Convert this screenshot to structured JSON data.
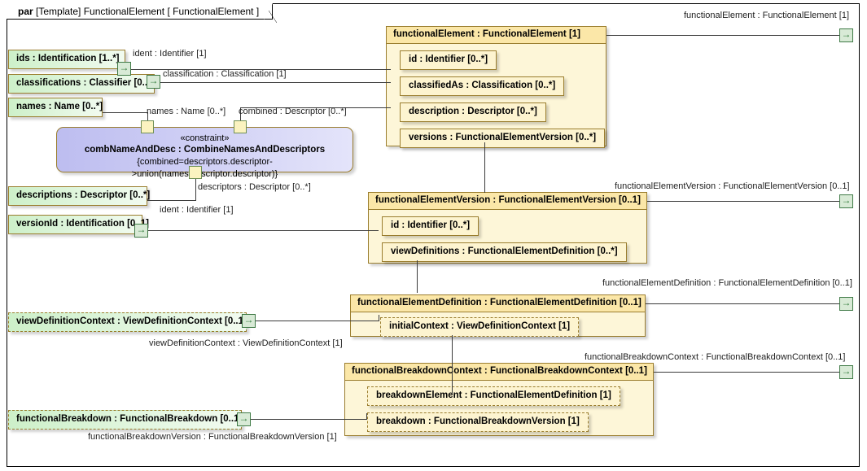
{
  "frame": {
    "keyword": "par",
    "title": "[Template] FunctionalElement [ FunctionalElement ]"
  },
  "blocks": [
    {
      "id": "functionalElement",
      "header": "functionalElement : FunctionalElement [1]",
      "properties": [
        "id : Identifier [0..*]",
        "classifiedAs : Classification [0..*]",
        "description : Descriptor [0..*]",
        "versions : FunctionalElementVersion [0..*]"
      ]
    },
    {
      "id": "functionalElementVersion",
      "header": "functionalElementVersion : FunctionalElementVersion [0..1]",
      "properties": [
        "id : Identifier [0..*]",
        "viewDefinitions : FunctionalElementDefinition [0..*]"
      ]
    },
    {
      "id": "functionalElementDefinition",
      "header": "functionalElementDefinition : FunctionalElementDefinition [0..1]",
      "properties": [
        "initialContext : ViewDefinitionContext [1]"
      ]
    },
    {
      "id": "functionalBreakdownContext",
      "header": "functionalBreakdownContext : FunctionalBreakdownContext [0..1]",
      "properties": [
        "breakdownElement : FunctionalElementDefinition [1]",
        "breakdown : FunctionalBreakdownVersion [1]"
      ]
    }
  ],
  "external_parts": [
    {
      "id": "ids",
      "label": "ids : Identification [1..*]"
    },
    {
      "id": "classifications",
      "label": "classifications : Classifier [0..*]"
    },
    {
      "id": "names",
      "label": "names : Name [0..*]"
    },
    {
      "id": "descriptions",
      "label": "descriptions : Descriptor [0..*]"
    },
    {
      "id": "versionId",
      "label": "versionId : Identification [0..1]"
    },
    {
      "id": "viewDefinitionContext",
      "label": "viewDefinitionContext : ViewDefinitionContext [0..1]"
    },
    {
      "id": "functionalBreakdown",
      "label": "functionalBreakdown : FunctionalBreakdown [0..1]"
    }
  ],
  "constraint": {
    "stereotype": "«constraint»",
    "name": "combNameAndDesc : CombineNamesAndDescriptors",
    "expression": "{combined=descriptors.descriptor->union(names.descriptor.descriptor)}"
  },
  "edge_labels": {
    "ident_1": "ident : Identifier [1]",
    "classification": "classification : Classification [1]",
    "names": "names : Name [0..*]",
    "combined": "combined : Descriptor [0..*]",
    "descriptors": "descriptors : Descriptor [0..*]",
    "ident_2": "ident : Identifier [1]",
    "viewDefinitionContext": "viewDefinitionContext : ViewDefinitionContext [1]",
    "functionalBreakdownVersion": "functionalBreakdownVersion : FunctionalBreakdownVersion [1]"
  },
  "frame_port_labels": {
    "functionalElement": "functionalElement : FunctionalElement [1]",
    "functionalElementVersion": "functionalElementVersion : FunctionalElementVersion [0..1]",
    "functionalElementDefinition": "functionalElementDefinition : FunctionalElementDefinition [0..1]",
    "functionalBreakdownContext": "functionalBreakdownContext : FunctionalBreakdownContext [0..1]"
  },
  "colors": {
    "block_fill": "#fdf6d8",
    "block_header": "#fbe7a8",
    "block_border": "#9a7d2e",
    "external_part_fill": "#ccf0c8",
    "constraint_fill": "#bdbdf0",
    "port_fill": "#d8ead6",
    "port_border": "#3f7a46",
    "connector": "#3a3a3a"
  }
}
